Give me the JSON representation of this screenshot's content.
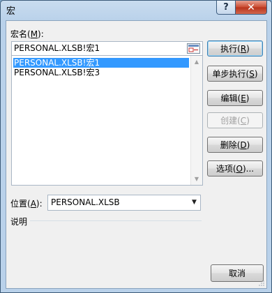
{
  "window": {
    "title": "宏",
    "help_glyph": "?",
    "close_glyph": "✕"
  },
  "macro_name": {
    "label_prefix": "宏名(",
    "label_key": "M",
    "label_suffix": "):",
    "value": "PERSONAL.XLSB!宏1",
    "ref_icon": "range-select-icon"
  },
  "macro_list": {
    "items": [
      {
        "label": "PERSONAL.XLSB!宏1",
        "selected": true
      },
      {
        "label": "PERSONAL.XLSB!宏3",
        "selected": false
      }
    ],
    "selected_color": "#3399ff"
  },
  "buttons": [
    {
      "name": "run-button",
      "prefix": "执行(",
      "key": "R",
      "suffix": ")",
      "enabled": true,
      "primary": true
    },
    {
      "name": "step-into-button",
      "prefix": "单步执行(",
      "key": "S",
      "suffix": ")",
      "enabled": true,
      "primary": false
    },
    {
      "name": "edit-button",
      "prefix": "编辑(",
      "key": "E",
      "suffix": ")",
      "enabled": true,
      "primary": false
    },
    {
      "name": "create-button",
      "prefix": "创建(",
      "key": "C",
      "suffix": ")",
      "enabled": false,
      "primary": false
    },
    {
      "name": "delete-button",
      "prefix": "删除(",
      "key": "D",
      "suffix": ")",
      "enabled": true,
      "primary": false
    },
    {
      "name": "options-button",
      "prefix": "选项(",
      "key": "O",
      "suffix": ")...",
      "enabled": true,
      "primary": false
    }
  ],
  "location": {
    "label_prefix": "位置(",
    "label_key": "A",
    "label_suffix": "):",
    "value": "PERSONAL.XLSB"
  },
  "description": {
    "label": "说明"
  },
  "cancel_label": "取消"
}
